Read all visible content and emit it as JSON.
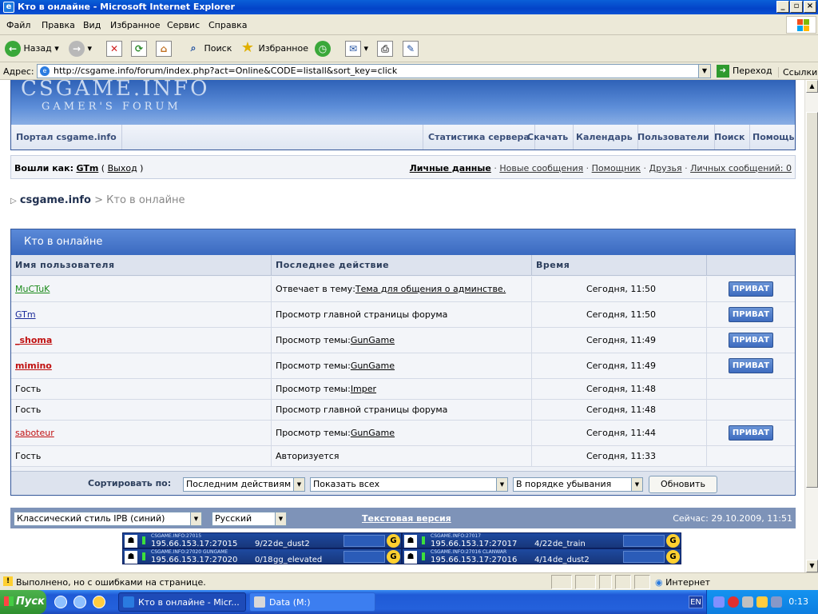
{
  "window": {
    "title": "Кто в онлайне - Microsoft Internet Explorer"
  },
  "menu": [
    "Файл",
    "Правка",
    "Вид",
    "Избранное",
    "Сервис",
    "Справка"
  ],
  "toolbar": {
    "back": "Назад",
    "search": "Поиск",
    "favorites": "Избранное"
  },
  "address": {
    "label": "Адрес:",
    "url": "http://csgame.info/forum/index.php?act=Online&CODE=listall&sort_key=click",
    "go": "Переход",
    "links": "Ссылки"
  },
  "banner": {
    "line1": "CSGAME.INFO",
    "line2": "GAMER'S FORUM"
  },
  "nav": {
    "portal": "Портал csgame.info",
    "items": [
      "Статистика сервера",
      "Скачать",
      "Календарь",
      "Пользователи",
      "Поиск",
      "Помощь"
    ]
  },
  "userbar": {
    "logged_as": "Вошли как:",
    "user": "GTm",
    "logout": "Выход",
    "links": [
      "Личные данные",
      "Новые сообщения",
      "Помощник",
      "Друзья",
      "Личных сообщений: 0"
    ]
  },
  "breadcrumb": {
    "home": "csgame.info",
    "sep": ">",
    "current": "Кто в онлайне"
  },
  "online": {
    "title": "Кто в онлайне",
    "headers": [
      "Имя пользователя",
      "Последнее действие",
      "Время",
      ""
    ],
    "pm_label": "ПРИВАТ",
    "rows": [
      {
        "user": "MuCTuK",
        "color": "#1a8a1a",
        "bold": false,
        "link": true,
        "action": "Отвечает в тему: ",
        "action_link": "Тема для общения о админстве.",
        "time": "Сегодня, 11:50",
        "pm": true
      },
      {
        "user": "GTm",
        "color": "#1a2a9a",
        "bold": false,
        "link": true,
        "action": "Просмотр главной страницы форума",
        "action_link": "",
        "time": "Сегодня, 11:50",
        "pm": true
      },
      {
        "user": "_shoma",
        "color": "#c01010",
        "bold": true,
        "link": true,
        "action": "Просмотр темы: ",
        "action_link": "GunGame",
        "time": "Сегодня, 11:49",
        "pm": true
      },
      {
        "user": "mimino",
        "color": "#c01010",
        "bold": true,
        "link": true,
        "action": "Просмотр темы: ",
        "action_link": "GunGame",
        "time": "Сегодня, 11:49",
        "pm": true
      },
      {
        "user": "Гость",
        "color": "#000000",
        "bold": false,
        "link": false,
        "action": "Просмотр темы: ",
        "action_link": "Imper",
        "time": "Сегодня, 11:48",
        "pm": false
      },
      {
        "user": "Гость",
        "color": "#000000",
        "bold": false,
        "link": false,
        "action": "Просмотр главной страницы форума",
        "action_link": "",
        "time": "Сегодня, 11:48",
        "pm": false
      },
      {
        "user": "saboteur",
        "color": "#c01010",
        "bold": false,
        "link": true,
        "action": "Просмотр темы: ",
        "action_link": "GunGame",
        "time": "Сегодня, 11:44",
        "pm": true
      },
      {
        "user": "Гость",
        "color": "#000000",
        "bold": false,
        "link": false,
        "action": "Авторизуется",
        "action_link": "",
        "time": "Сегодня, 11:33",
        "pm": false
      }
    ]
  },
  "sort": {
    "label": "Сортировать по:",
    "key": "Последним действиям",
    "filter": "Показать всех",
    "order": "В порядке убывания",
    "button": "Обновить"
  },
  "footer": {
    "skin": "Классический стиль IPB (синий)",
    "lang": "Русский",
    "text_version": "Текстовая версия",
    "now": "Сейчас: 29.10.2009, 11:51"
  },
  "servers": [
    {
      "name": "CSGAME.INFO:27015",
      "ip": "195.66.153.17:27015",
      "players": "9/22",
      "map": "de_dust2"
    },
    {
      "name": "CSGAME.INFO:27017",
      "ip": "195.66.153.17:27017",
      "players": "4/22",
      "map": "de_train"
    },
    {
      "name": "CSGAME.INFO:27020 GUNGAME",
      "ip": "195.66.153.17:27020",
      "players": "0/18",
      "map": "gg_elevated"
    },
    {
      "name": "CSGAME.INFO:27016 CLANWAR",
      "ip": "195.66.153.17:27016",
      "players": "4/14",
      "map": "de_dust2"
    }
  ],
  "status": {
    "text": "Выполнено, но с ошибками на странице.",
    "zone": "Интернет"
  },
  "taskbar": {
    "start": "Пуск",
    "tasks": [
      "Кто в онлайне - Micr...",
      "Data (M:)"
    ],
    "lang": "EN",
    "clock": "0:13"
  }
}
